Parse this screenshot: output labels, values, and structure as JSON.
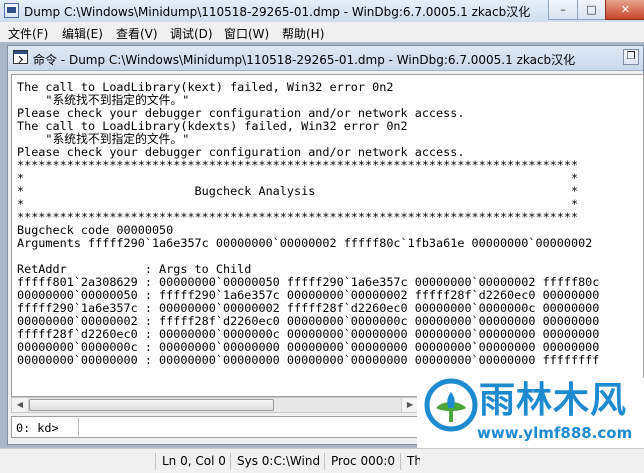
{
  "window": {
    "title": "Dump C:\\Windows\\Minidump\\110518-29265-01.dmp - WinDbg:6.7.0005.1 zkacb汉化",
    "minimize": "–",
    "maximize": "□",
    "close": "✕"
  },
  "menu": [
    "文件(F)",
    "编辑(E)",
    "查看(V)",
    "调试(D)",
    "窗口(W)",
    "帮助(H)"
  ],
  "command_window": {
    "title": "命令 - Dump C:\\Windows\\Minidump\\110518-29265-01.dmp - WinDbg:6.7.0005.1 zkacb汉化",
    "restore": "❐",
    "lines": [
      "The call to LoadLibrary(kext) failed, Win32 error 0n2",
      "    \"系统找不到指定的文件。\"",
      "Please check your debugger configuration and/or network access.",
      "The call to LoadLibrary(kdexts) failed, Win32 error 0n2",
      "    \"系统找不到指定的文件。\"",
      "Please check your debugger configuration and/or network access.",
      "*******************************************************************************",
      "*                                                                             *",
      "*                        Bugcheck Analysis                                    *",
      "*                                                                             *",
      "*******************************************************************************",
      "Bugcheck code 00000050",
      "Arguments fffff290`1a6e357c 00000000`00000002 fffff80c`1fb3a61e 00000000`00000002",
      "",
      "RetAddr           : Args to Child",
      "fffff801`2a308629 : 00000000`00000050 fffff290`1a6e357c 00000000`00000002 fffff80c",
      "00000000`00000050 : fffff290`1a6e357c 00000000`00000002 fffff28f`d2260ec0 00000000",
      "fffff290`1a6e357c : 00000000`00000002 fffff28f`d2260ec0 00000000`0000000c 00000000",
      "00000000`00000002 : fffff28f`d2260ec0 00000000`0000000c 00000000`00000000 00000000",
      "fffff28f`d2260ec0 : 00000000`0000000c 00000000`00000000 00000000`00000000 00000000",
      "00000000`0000000c : 00000000`00000000 00000000`00000000 00000000`00000000 00000000",
      "00000000`00000000 : 00000000`00000000 00000000`00000000 00000000`00000000 ffffffff"
    ],
    "prompt": "0: kd>",
    "command_value": ""
  },
  "watermark": {
    "text": "雨林木风",
    "url": "www.ylmf888.com",
    "accent": "#1e8bd0"
  },
  "status": [
    "Ln 0, Col 0",
    "Sys 0:C:\\Wind",
    "Proc 000:0",
    "Th"
  ]
}
